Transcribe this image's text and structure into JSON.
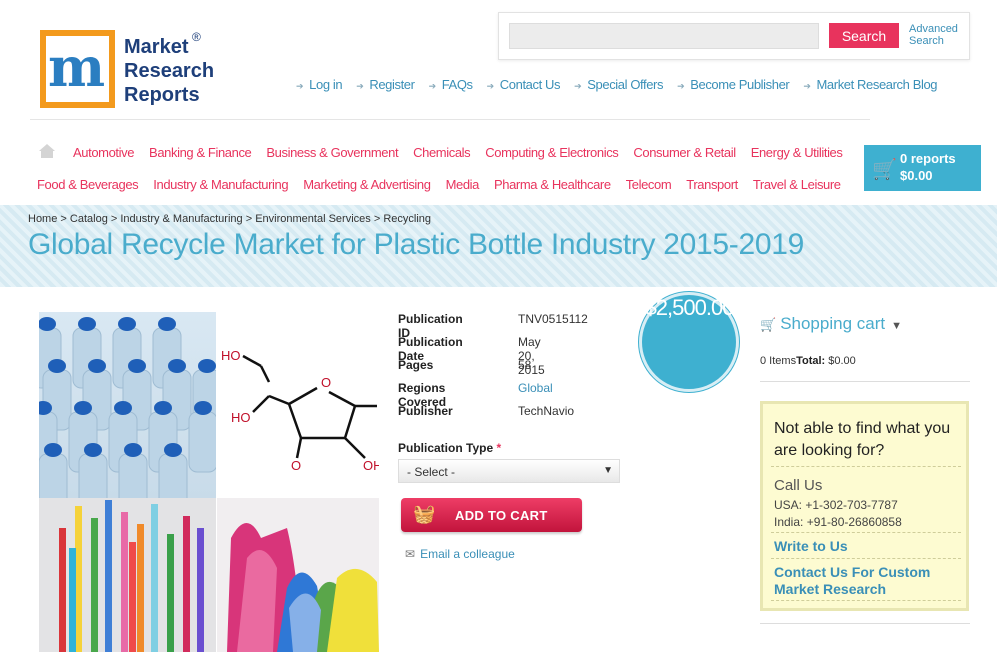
{
  "logo": {
    "line1": "Market",
    "line2": "Research",
    "line3": "Reports",
    "reg": "®"
  },
  "search": {
    "placeholder": "",
    "button": "Search",
    "advanced_line1": "Advanced",
    "advanced_line2": "Search"
  },
  "topnav": [
    "Log in",
    "Register",
    "FAQs",
    "Contact Us",
    "Special Offers",
    "Become Publisher",
    "Market Research Blog"
  ],
  "categories_row1": [
    "Automotive",
    "Banking & Finance",
    "Business & Government",
    "Chemicals",
    "Computing & Electronics",
    "Consumer & Retail",
    "Energy & Utilities"
  ],
  "categories_row2": [
    "Food & Beverages",
    "Industry & Manufacturing",
    "Marketing & Advertising",
    "Media",
    "Pharma & Healthcare",
    "Telecom",
    "Transport",
    "Travel & Leisure"
  ],
  "cart_button": {
    "reports": "0 reports",
    "total": "$0.00"
  },
  "breadcrumb": [
    "Home",
    "Catalog",
    "Industry & Manufacturing",
    "Environmental Services",
    "Recycling"
  ],
  "title": "Global Recycle Market for Plastic Bottle Industry 2015-2019",
  "details": {
    "publication_id_label": "Publication ID",
    "publication_id": "TNV0515112",
    "publication_date_label": "Publication Date",
    "publication_date": "May 20, 2015",
    "pages_label": "Pages",
    "pages": "58",
    "regions_label": "Regions Covered",
    "regions": "Global",
    "publisher_label": "Publisher",
    "publisher": "TechNavio"
  },
  "price": "$2,500.00",
  "publication_type": {
    "label": "Publication Type",
    "required_mark": "*",
    "selected": "- Select -"
  },
  "add_to_cart": "ADD TO CART",
  "email_colleague": "Email a colleague",
  "shopping_cart": {
    "title": "Shopping cart",
    "items": "0 Items",
    "total_label": "Total:",
    "total": "$0.00"
  },
  "help": {
    "heading": "Not able to find what you are looking for?",
    "call_us": "Call Us",
    "usa": "USA: +1-302-703-7787",
    "india": "India: +91-80-26860858",
    "write_to_us": "Write to Us",
    "custom": "Contact Us For Custom Market Research"
  },
  "colors": {
    "accent_blue": "#3eb0d0",
    "accent_pink": "#e8335d",
    "link_blue": "#3a8fb7",
    "logo_orange": "#f39a1d"
  },
  "structural_chars": {
    "crumb_sep": " > "
  }
}
